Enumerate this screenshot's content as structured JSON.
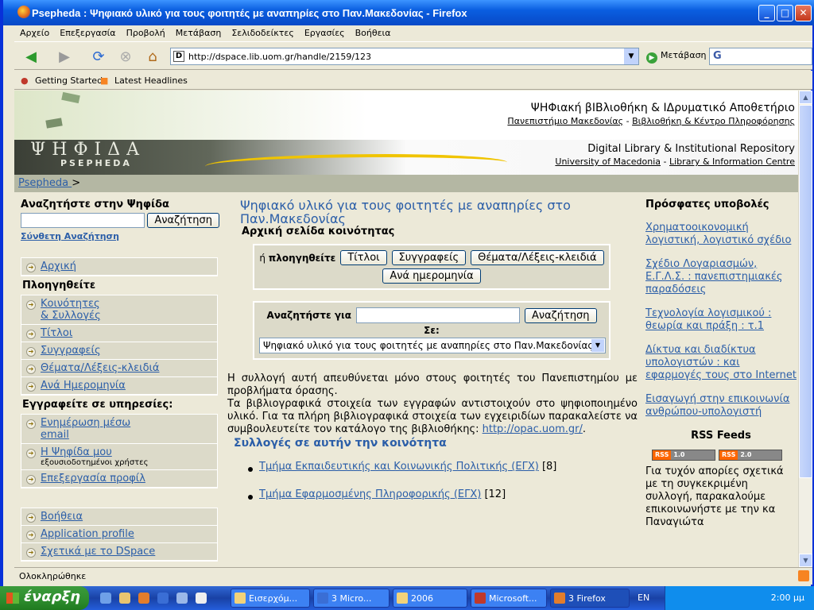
{
  "window": {
    "title": "Psepheda : Ψηφιακό υλικό για τους φοιτητές με αναπηρίες στο Παν.Μακεδονίας - Firefox"
  },
  "menu": [
    "Αρχείο",
    "Επεξεργασία",
    "Προβολή",
    "Μετάβαση",
    "Σελιδοδείκτες",
    "Εργασίες",
    "Βοήθεια"
  ],
  "toolbar": {
    "url": "http://dspace.lib.uom.gr/handle/2159/123",
    "go_label": "Μετάβαση",
    "search_logo": "G"
  },
  "bookmarks": [
    "Getting Started",
    "Latest Headlines"
  ],
  "header": {
    "greek_title": "ΨΗΦιακή βΙΒλιοθήκη & ΙΔρυματικό Αποθετήριο",
    "greek_links": [
      "Πανεπιστήμιο Μακεδονίας",
      "Βιβλιοθήκη & Κέντρο Πληροφόρησης"
    ],
    "english_title": "Digital Library & Institutional Repository",
    "english_links": [
      "University of Macedonia",
      "Library & Information Centre"
    ],
    "logo_greek": "ΨΗΦΙΔΑ",
    "logo_latin": "PSEPHEDA",
    "sep": " - "
  },
  "breadcrumb": {
    "home": "Psepheda ",
    "sep": ">"
  },
  "left": {
    "search_heading": "Αναζητήστε στην Ψηφίδα",
    "search_button": "Αναζήτηση",
    "advanced": "Σύνθετη Αναζήτηση",
    "home": "Αρχική",
    "browse_heading": "Πλοηγηθείτε",
    "browse_items": [
      "Κοινότητες",
      "& Συλλογές",
      "Τίτλοι",
      "Συγγραφείς",
      "Θέματα/Λέξεις-κλειδιά",
      "Ανά Ημερομηνία"
    ],
    "subscribe_heading": "Εγγραφείτε σε υπηρεσίες:",
    "alert_1": "Ενημέρωση μέσω ",
    "alert_2": "email",
    "mypsepheda": "Η Ψηφίδα μου",
    "mypsepheda_note": "εξουσιοδοτημένοι χρήστες",
    "edit_profile": "Επεξεργασία προφίλ",
    "help": "Βοήθεια",
    "app_profile": "Application profile",
    "about": "Σχετικά με το DSpace"
  },
  "center": {
    "title": "Ψηφιακό υλικό για τους φοιτητές με αναπηρίες στο Παν.Μακεδονίας",
    "subtitle": "Αρχική σελίδα κοινότητας",
    "browse_prefix": "ή ",
    "browse_label": "πλοηγηθείτε",
    "browse_buttons": [
      "Τίτλοι",
      "Συγγραφείς",
      "Θέματα/Λέξεις-κλειδιά",
      "Ανά ημερομηνία"
    ],
    "search_label": "Αναζητήστε για",
    "search_button": "Αναζήτηση",
    "in_label": "Σε:",
    "scope_selected": "Ψηφιακό υλικό για τους φοιτητές με αναπηρίες στο Παν.Μακεδονίας",
    "desc1": "Η συλλογή αυτή απευθύνεται μόνο στους φοιτητές του Πανεπιστημίου με προβλήματα όρασης.",
    "desc2": "Τα βιβλιογραφικά στοιχεία των εγγραφών αντιστοιχούν στο ψηφιοποιημένο υλικό. Για τα πλήρη βιβλιογραφικά στοιχεία των εγχειριδίων παρακαλείστε να συμβουλευτείτε τον κατάλογο της βιβλιοθήκης: ",
    "opac": "http://opac.uom.gr/",
    "desc_end": ".",
    "collections_heading": "Συλλογές σε αυτήν την κοινότητα",
    "collections": [
      {
        "name": "Τμήμα Εκπαιδευτικής και Κοινωνικής Πολιτικής (ΕΓΧ)",
        "count": "[8]"
      },
      {
        "name": "Τμήμα Εφαρμοσμένης Πληροφορικής (ΕΓΧ)",
        "count": "[12]"
      }
    ]
  },
  "right": {
    "heading": "Πρόσφατες υποβολές",
    "items": [
      "Χρηματοοικονομική λογιστική, λογιστικό σχέδιο",
      "Σχέδιο Λογαριασμών, Ε.Γ.Λ.Σ. : πανεπιστημιακές παραδόσεις",
      "Τεχνολογία λογισμικού : θεωρία και πράξη : τ.1",
      "Δίκτυα και διαδίκτυα υπολογιστών : και εφαρμογές τους στο Internet",
      "Εισαγωγή στην επικοινωνία ανθρώπου-υπολογιστή"
    ],
    "rss_heading": "RSS Feeds",
    "rss_badges": [
      {
        "a": "RSS",
        "b": "1.0"
      },
      {
        "a": "RSS",
        "b": "2.0"
      }
    ],
    "rss_text": "Για τυχόν απορίες σχετικά με τη συγκεκριμένη συλλογή, παρακαλούμε επικοινωνήστε με την κα Παναγιώτα"
  },
  "status": "Ολοκληρώθηκε",
  "taskbar": {
    "start": "έναρξη",
    "tasks": [
      "Εισερχόμ...",
      "3 Micro...",
      "2006",
      "Microsoft...",
      "3 Firefox"
    ],
    "lang": "EN",
    "clock": "2:00 μμ"
  }
}
